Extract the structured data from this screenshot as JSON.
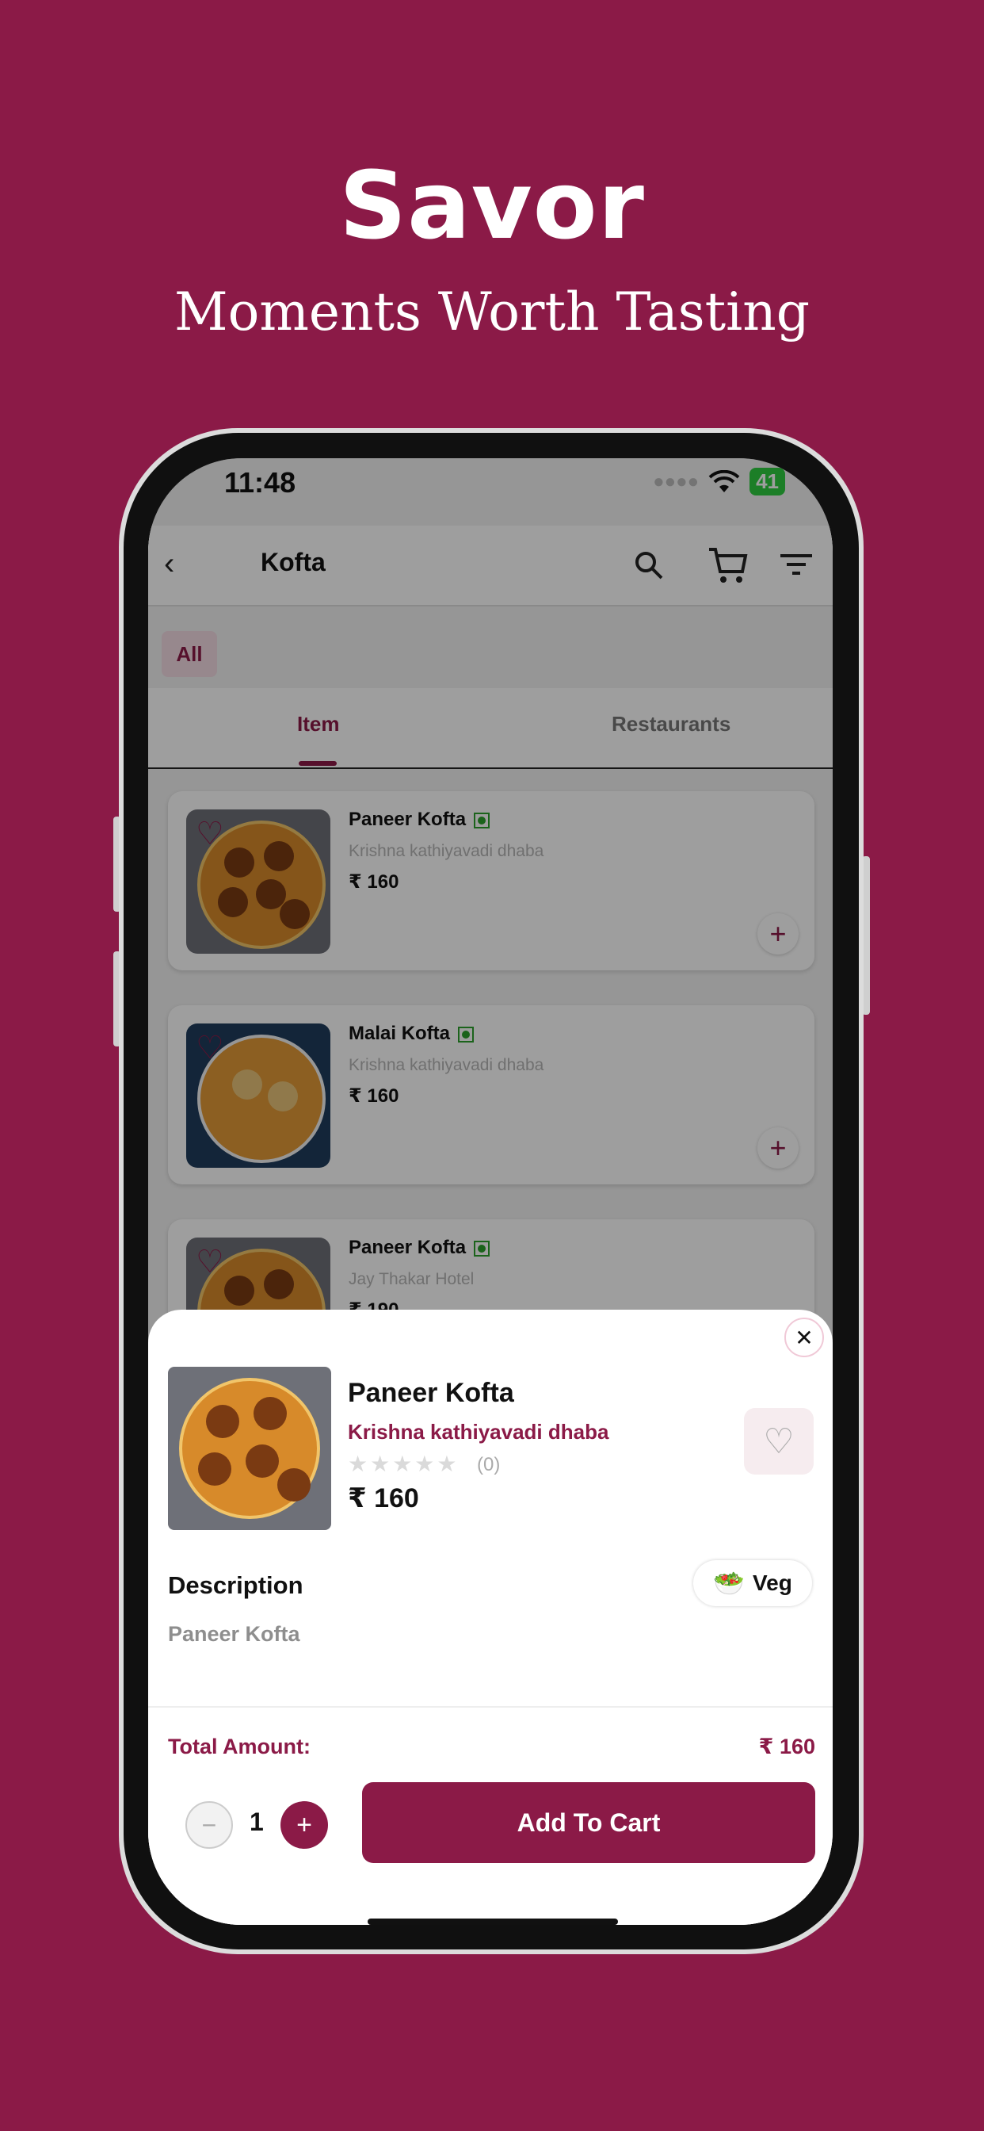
{
  "promo": {
    "headline": "Savor",
    "subline": "Moments Worth Tasting"
  },
  "status_bar": {
    "time": "11:48",
    "battery": "41"
  },
  "navbar": {
    "title": "Kofta"
  },
  "filters": {
    "chip": "All"
  },
  "tabs": [
    {
      "label": "Item",
      "active": true
    },
    {
      "label": "Restaurants",
      "active": false
    }
  ],
  "items": [
    {
      "name": "Paneer Kofta",
      "restaurant": "Krishna kathiyavadi dhaba",
      "price": "₹ 160"
    },
    {
      "name": "Malai Kofta",
      "restaurant": "Krishna kathiyavadi dhaba",
      "price": "₹ 160"
    },
    {
      "name": "Paneer Kofta",
      "restaurant": "Jay Thakar Hotel",
      "price": "₹ 190"
    }
  ],
  "sheet": {
    "name": "Paneer Kofta",
    "restaurant": "Krishna kathiyavadi dhaba",
    "rating_count": "(0)",
    "price": "₹ 160",
    "description_label": "Description",
    "description": "Paneer Kofta",
    "veg_label": "Veg",
    "total_label": "Total Amount:",
    "total_value": "₹ 160",
    "quantity": "1",
    "add_to_cart": "Add To Cart"
  },
  "colors": {
    "brand": "#8b1a47",
    "veg": "#2ca02c"
  }
}
